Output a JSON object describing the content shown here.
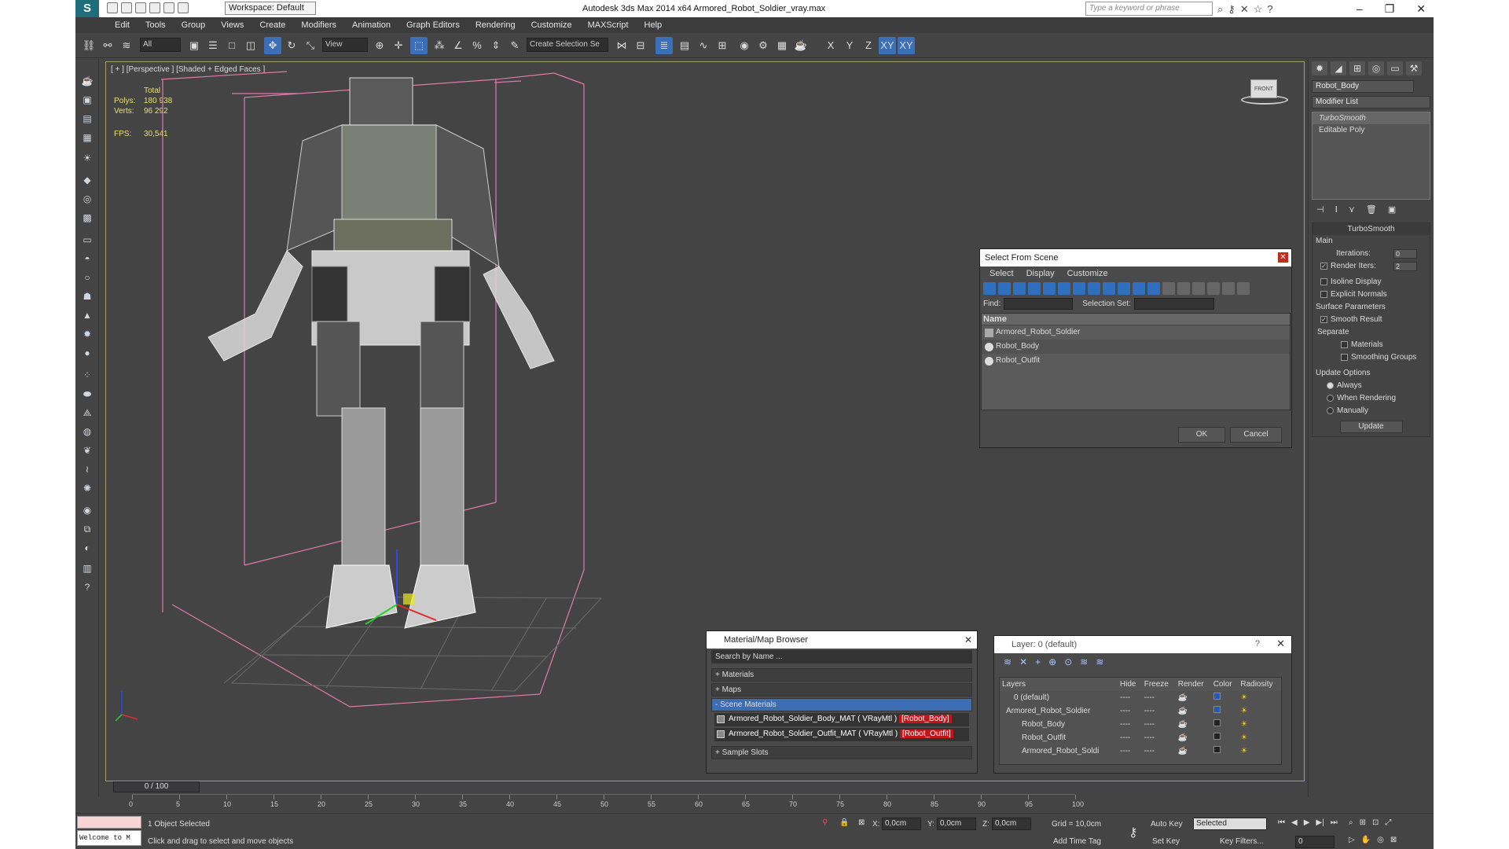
{
  "titlebar": {
    "workspace": "Workspace: Default",
    "title": "Autodesk 3ds Max  2014 x64     Armored_Robot_Soldier_vray.max",
    "search_placeholder": "Type a keyword or phrase"
  },
  "menu": [
    "Edit",
    "Tools",
    "Group",
    "Views",
    "Create",
    "Modifiers",
    "Animation",
    "Graph Editors",
    "Rendering",
    "Customize",
    "MAXScript",
    "Help"
  ],
  "toolbar": {
    "selection_filter": "All",
    "ref_coord": "View",
    "named_selection": "Create Selection Se",
    "axis_labels": [
      "X",
      "Y",
      "Z",
      "XY",
      "XY"
    ]
  },
  "viewport": {
    "label": "[ + ] [Perspective ] [Shaded + Edged Faces ]",
    "stats_header": "Total",
    "polys_label": "Polys:",
    "polys_value": "180 938",
    "verts_label": "Verts:",
    "verts_value": "96 292",
    "fps_label": "FPS:",
    "fps_value": "30,541",
    "viewcube_label": "FRONT"
  },
  "command_panel": {
    "object_name": "Robot_Body",
    "modifier_list": "Modifier List",
    "stack": [
      "TurboSmooth",
      "Editable Poly"
    ],
    "rollout_title": "TurboSmooth",
    "main_label": "Main",
    "iterations_label": "Iterations:",
    "iterations_value": "0",
    "render_iters_label": "Render Iters:",
    "render_iters_value": "2",
    "isoline": "Isoline Display",
    "explicit_normals": "Explicit Normals",
    "surface_params": "Surface Parameters",
    "smooth_result": "Smooth Result",
    "separate": "Separate",
    "materials": "Materials",
    "smoothing_groups": "Smoothing Groups",
    "update_options": "Update Options",
    "always": "Always",
    "when_rendering": "When Rendering",
    "manually": "Manually",
    "update_btn": "Update"
  },
  "select_from_scene": {
    "title": "Select From Scene",
    "menu": [
      "Select",
      "Display",
      "Customize"
    ],
    "find_label": "Find:",
    "selection_set_label": "Selection Set:",
    "column": "Name",
    "items": [
      "Armored_Robot_Soldier",
      "Robot_Body",
      "Robot_Outfit"
    ],
    "ok": "OK",
    "cancel": "Cancel"
  },
  "material_browser": {
    "title": "Material/Map Browser",
    "search_placeholder": "Search by Name ...",
    "groups": [
      "+ Materials",
      "+ Maps",
      "- Scene Materials",
      "+ Sample Slots"
    ],
    "materials": [
      {
        "name": "Armored_Robot_Soldier_Body_MAT ( VRayMtl ) ",
        "tag": "[Robot_Body]"
      },
      {
        "name": "Armored_Robot_Soldier_Outfit_MAT ( VRayMtl ) ",
        "tag": "[Robot_Outfit]"
      }
    ]
  },
  "layer_dialog": {
    "title": "Layer: 0 (default)",
    "columns": [
      "Layers",
      "Hide",
      "Freeze",
      "Render",
      "Color",
      "Radiosity"
    ],
    "rows": [
      {
        "name": "0 (default)",
        "color": "#1f56c9"
      },
      {
        "name": "Armored_Robot_Soldier",
        "color": "#1f56c9"
      },
      {
        "name": "Robot_Body",
        "color": "#222222"
      },
      {
        "name": "Robot_Outfit",
        "color": "#222222"
      },
      {
        "name": "Armored_Robot_Soldi",
        "color": "#222222"
      }
    ]
  },
  "timeline": {
    "frame": "0 / 100",
    "ticks": [
      "0",
      "5",
      "10",
      "15",
      "20",
      "25",
      "30",
      "35",
      "40",
      "45",
      "50",
      "55",
      "60",
      "65",
      "70",
      "75",
      "80",
      "85",
      "90",
      "95",
      "100"
    ]
  },
  "statusbar": {
    "maxscript": "Welcome to M",
    "selected": "1 Object Selected",
    "prompt": "Click and drag to select and move objects",
    "x_label": "X:",
    "x_value": "0,0cm",
    "y_label": "Y:",
    "y_value": "0,0cm",
    "z_label": "Z:",
    "z_value": "0,0cm",
    "grid": "Grid = 10,0cm",
    "add_time_tag": "Add Time Tag",
    "auto_key": "Auto Key",
    "set_key": "Set Key",
    "selected_dropdown": "Selected",
    "key_filters": "Key Filters...",
    "current_frame": "0"
  }
}
